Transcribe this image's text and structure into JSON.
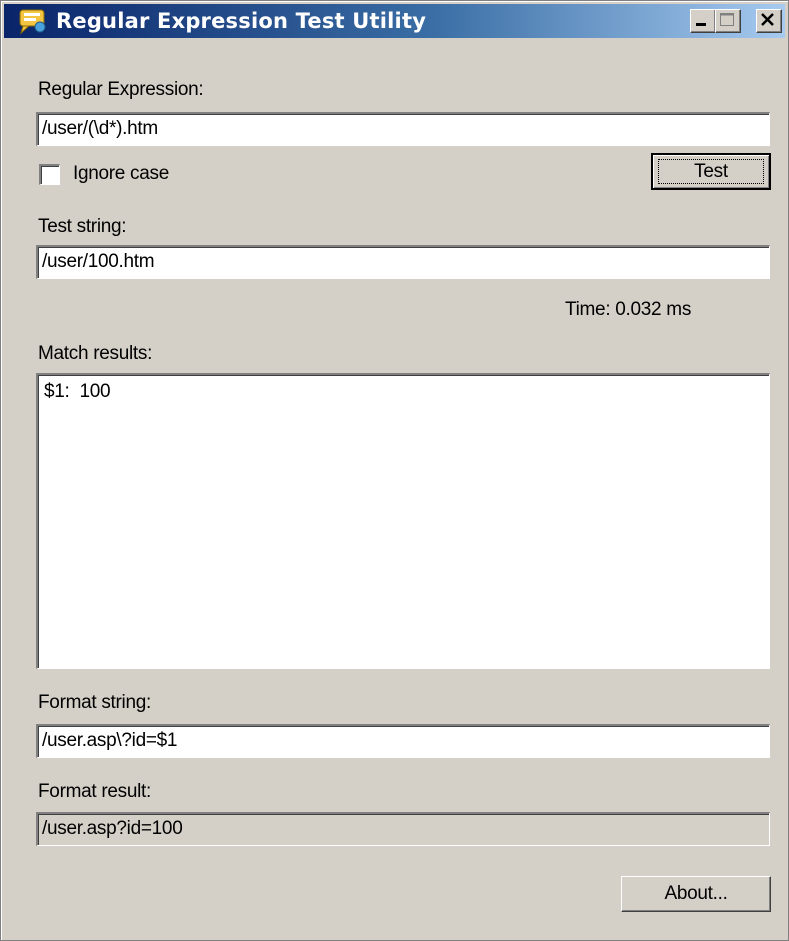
{
  "window": {
    "title": "Regular Expression Test Utility",
    "icon": "regex-app-icon",
    "controls": [
      "minimize-icon",
      "maximize-icon",
      "close-icon"
    ]
  },
  "form": {
    "regex_label": "Regular Expression:",
    "regex_value": "/user/(\\d*).htm",
    "ignore_case_label": "Ignore case",
    "ignore_case_checked": false,
    "test_button": "Test",
    "test_string_label": "Test string:",
    "test_string_value": "/user/100.htm",
    "time_text": "Time: 0.032 ms",
    "match_results_label": "Match results:",
    "match_results_value": "$1:  100",
    "format_string_label": "Format string:",
    "format_string_value": "/user.asp\\?id=$1",
    "format_result_label": "Format result:",
    "format_result_value": "/user.asp?id=100",
    "about_button": "About..."
  },
  "colors": {
    "face": "#d4d0c8",
    "title_start": "#0a246a",
    "title_end": "#a6caf0"
  }
}
